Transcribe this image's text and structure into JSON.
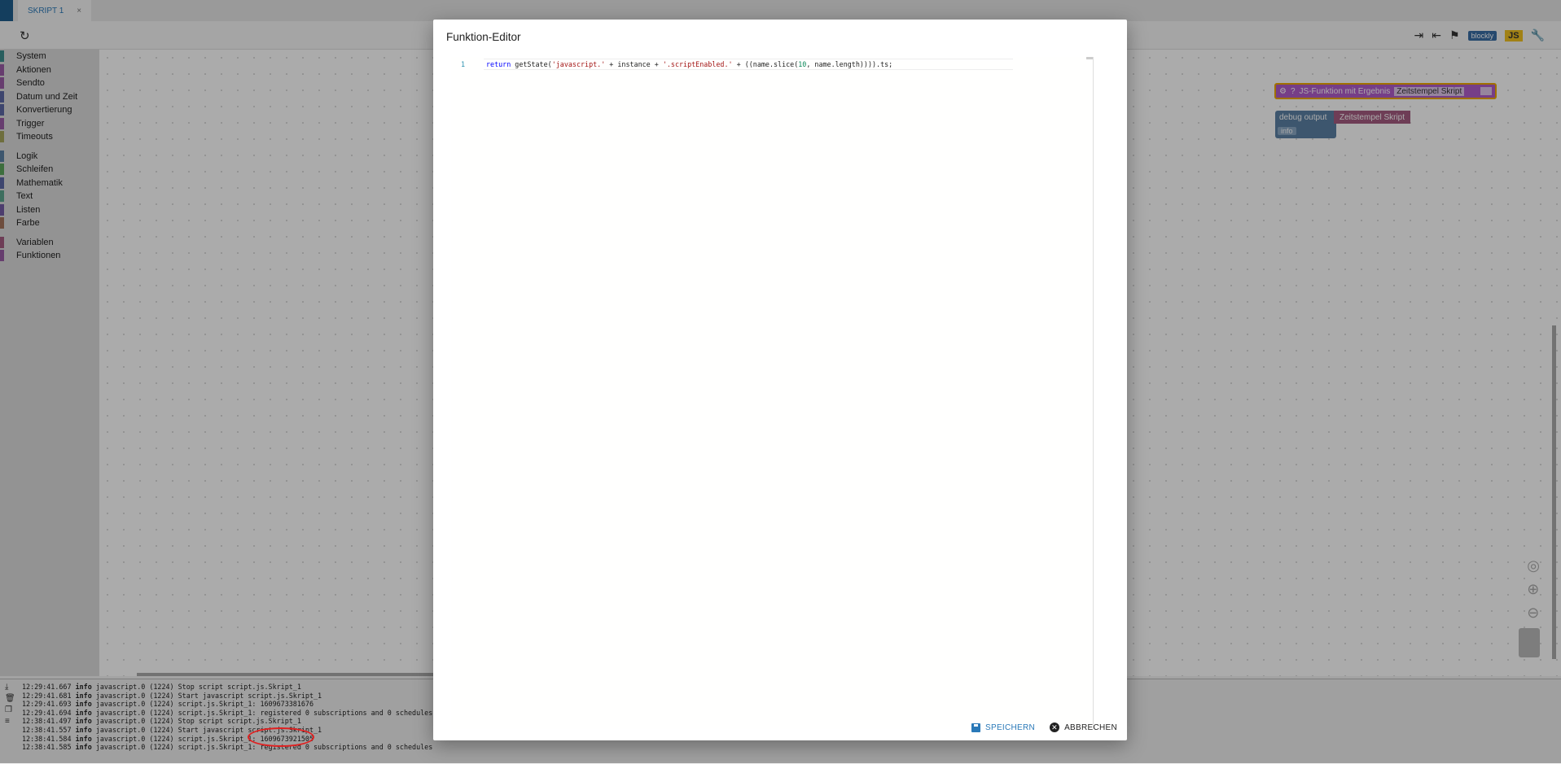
{
  "tab": {
    "label": "SKRIPT 1",
    "close": "×"
  },
  "toolbar": {
    "blockly_label": "blockly",
    "js_label": "JS"
  },
  "sidebar": {
    "categories": [
      {
        "label": "System",
        "color": "#3c8c8c"
      },
      {
        "label": "Aktionen",
        "color": "#9a5ca6"
      },
      {
        "label": "Sendto",
        "color": "#9a5ca6"
      },
      {
        "label": "Datum und Zeit",
        "color": "#5b67a5"
      },
      {
        "label": "Konvertierung",
        "color": "#5b67a5"
      },
      {
        "label": "Trigger",
        "color": "#9a5ca6"
      },
      {
        "label": "Timeouts",
        "color": "#a5a55b"
      },
      {
        "label": "Logik",
        "color": "#5b80a5"
      },
      {
        "label": "Schleifen",
        "color": "#5ba55b"
      },
      {
        "label": "Mathematik",
        "color": "#5b67a5"
      },
      {
        "label": "Text",
        "color": "#5ba58c"
      },
      {
        "label": "Listen",
        "color": "#745ba5"
      },
      {
        "label": "Farbe",
        "color": "#a5745b"
      },
      {
        "label": "Variablen",
        "color": "#a55b80"
      },
      {
        "label": "Funktionen",
        "color": "#995ba5"
      }
    ]
  },
  "workspace": {
    "js_block_label": "JS-Funktion mit Ergebnis",
    "js_block_field": "Zeitstempel Skript",
    "debug_label": "debug output",
    "debug_level": "info",
    "text_block": "Zeitstempel Skript"
  },
  "log": {
    "lines": [
      {
        "time": "12:29:41.667",
        "level": "info",
        "msg": "javascript.0 (1224) Stop script script.js.Skript_1"
      },
      {
        "time": "12:29:41.681",
        "level": "info",
        "msg": "javascript.0 (1224) Start javascript script.js.Skript_1"
      },
      {
        "time": "12:29:41.693",
        "level": "info",
        "msg": "javascript.0 (1224) script.js.Skript_1: 1609673381676"
      },
      {
        "time": "12:29:41.694",
        "level": "info",
        "msg": "javascript.0 (1224) script.js.Skript_1: registered 0 subscriptions and 0 schedules"
      },
      {
        "time": "12:38:41.497",
        "level": "info",
        "msg": "javascript.0 (1224) Stop script script.js.Skript_1"
      },
      {
        "time": "12:38:41.557",
        "level": "info",
        "msg": "javascript.0 (1224) Start javascript script.js.Skript_1"
      },
      {
        "time": "12:38:41.584",
        "level": "info",
        "msg": "javascript.0 (1224) script.js.Skript_1: 1609673921505"
      },
      {
        "time": "12:38:41.585",
        "level": "info",
        "msg": "javascript.0 (1224) script.js.Skript_1: registered 0 subscriptions and 0 schedules"
      }
    ]
  },
  "dialog": {
    "title": "Funktion-Editor",
    "line_number": "1",
    "code": {
      "kw": "return",
      "p1": " getState(",
      "s1": "'javascript.'",
      "p2": " + instance + ",
      "s2": "'.scriptEnabled.'",
      "p3": " + ((name.slice(",
      "n1": "10",
      "p4": ", name.length)))).ts;"
    },
    "save_label": "SPEICHERN",
    "cancel_label": "ABBRECHEN"
  }
}
